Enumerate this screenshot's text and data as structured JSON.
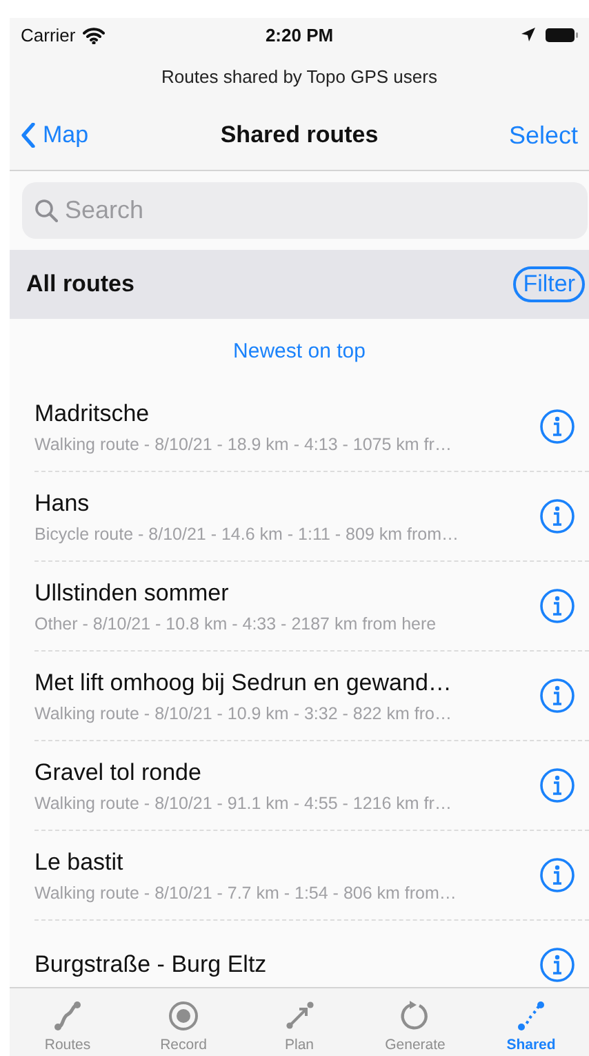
{
  "status_bar": {
    "carrier": "Carrier",
    "time": "2:20 PM"
  },
  "header": {
    "subtitle": "Routes shared by Topo GPS users",
    "back": "Map",
    "title": "Shared routes",
    "action": "Select"
  },
  "search": {
    "placeholder": "Search"
  },
  "section": {
    "title": "All routes",
    "filter": "Filter"
  },
  "sort_label": "Newest on top",
  "routes": [
    {
      "name": "Madritsche",
      "details": "Walking route - 8/10/21 - 18.9 km - 4:13 - 1075 km fr…"
    },
    {
      "name": "Hans",
      "details": "Bicycle route - 8/10/21 - 14.6 km - 1:11 - 809 km from…"
    },
    {
      "name": "Ullstinden sommer",
      "details": "Other - 8/10/21 - 10.8 km - 4:33 - 2187 km from here"
    },
    {
      "name": "Met lift omhoog bij Sedrun en gewand…",
      "details": "Walking route - 8/10/21 - 10.9 km - 3:32 - 822 km fro…"
    },
    {
      "name": "Gravel tol ronde",
      "details": "Walking route - 8/10/21 - 91.1 km - 4:55 - 1216 km fr…"
    },
    {
      "name": "Le bastit",
      "details": "Walking route - 8/10/21 - 7.7 km - 1:54 - 806 km from…"
    },
    {
      "name": "Burgstraße - Burg Eltz"
    }
  ],
  "tabs": [
    {
      "kind": "routes",
      "label": "Routes",
      "selected": false
    },
    {
      "kind": "record",
      "label": "Record",
      "selected": false
    },
    {
      "kind": "plan",
      "label": "Plan",
      "selected": false
    },
    {
      "kind": "generate",
      "label": "Generate",
      "selected": false
    },
    {
      "kind": "shared",
      "label": "Shared",
      "selected": true
    }
  ]
}
